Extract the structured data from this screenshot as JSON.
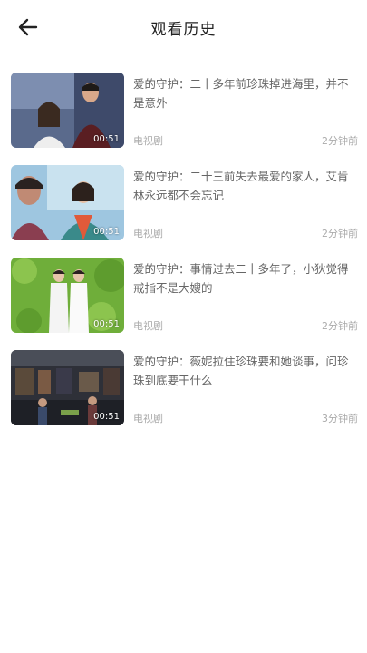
{
  "header": {
    "title": "观看历史"
  },
  "items": [
    {
      "title": "爱的守护：二十多年前珍珠掉进海里，并不是意外",
      "duration": "00:51",
      "category": "电视剧",
      "time": "2分钟前"
    },
    {
      "title": "爱的守护：二十三前失去最爱的家人，艾肯林永远都不会忘记",
      "duration": "00:51",
      "category": "电视剧",
      "time": "2分钟前"
    },
    {
      "title": "爱的守护：事情过去二十多年了，小狄觉得戒指不是大嫂的",
      "duration": "00:51",
      "category": "电视剧",
      "time": "2分钟前"
    },
    {
      "title": "爱的守护：薇妮拉住珍珠要和她谈事，问珍珠到底要干什么",
      "duration": "00:51",
      "category": "电视剧",
      "time": "3分钟前"
    }
  ]
}
